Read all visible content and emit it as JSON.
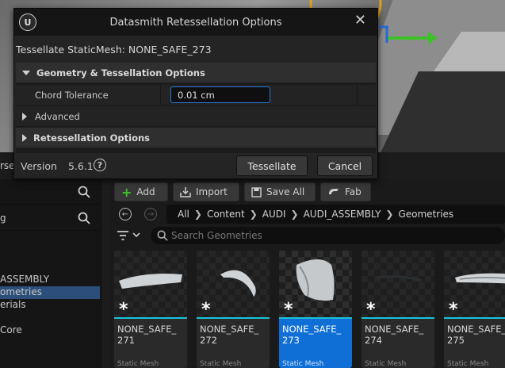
{
  "dialog": {
    "title": "Datasmith Retessellation Options",
    "subtitle": "Tessellate StaticMesh: NONE_SAFE_273",
    "sections": {
      "geometry": "Geometry & Tessellation Options",
      "advanced": "Advanced",
      "retessellation": "Retessellation Options"
    },
    "chord_tolerance": {
      "label": "Chord Tolerance",
      "value": "0.01 cm"
    },
    "version_label": "Version",
    "version_value": "5.6.1",
    "tessellate_label": "Tessellate",
    "cancel_label": "Cancel"
  },
  "left_panel": {
    "edge_text": "rse",
    "filter_text": "g",
    "tree": [
      "ASSEMBLY",
      "ometries",
      "erials",
      "Core"
    ]
  },
  "content_browser": {
    "add_label": "Add",
    "import_label": "Import",
    "save_all_label": "Save All",
    "fab_label": "Fab",
    "breadcrumbs": [
      "All",
      "Content",
      "AUDI",
      "AUDI_ASSEMBLY",
      "Geometries"
    ],
    "search_placeholder": "Search Geometries",
    "assets": [
      {
        "name": "NONE_SAFE_\n271",
        "type": "Static Mesh",
        "selected": false
      },
      {
        "name": "NONE_SAFE_\n272",
        "type": "Static Mesh",
        "selected": false
      },
      {
        "name": "NONE_SAFE_\n273",
        "type": "Static Mesh",
        "selected": true
      },
      {
        "name": "NONE_SAFE_\n274",
        "type": "Static Mesh",
        "selected": false
      },
      {
        "name": "NONE_SAFE_\n275",
        "type": "Static Mesh",
        "selected": false
      }
    ]
  },
  "colors": {
    "selection": "#0f6fd6",
    "accent_cyan": "#19c3d9",
    "input_focus": "#2a7ad6"
  }
}
